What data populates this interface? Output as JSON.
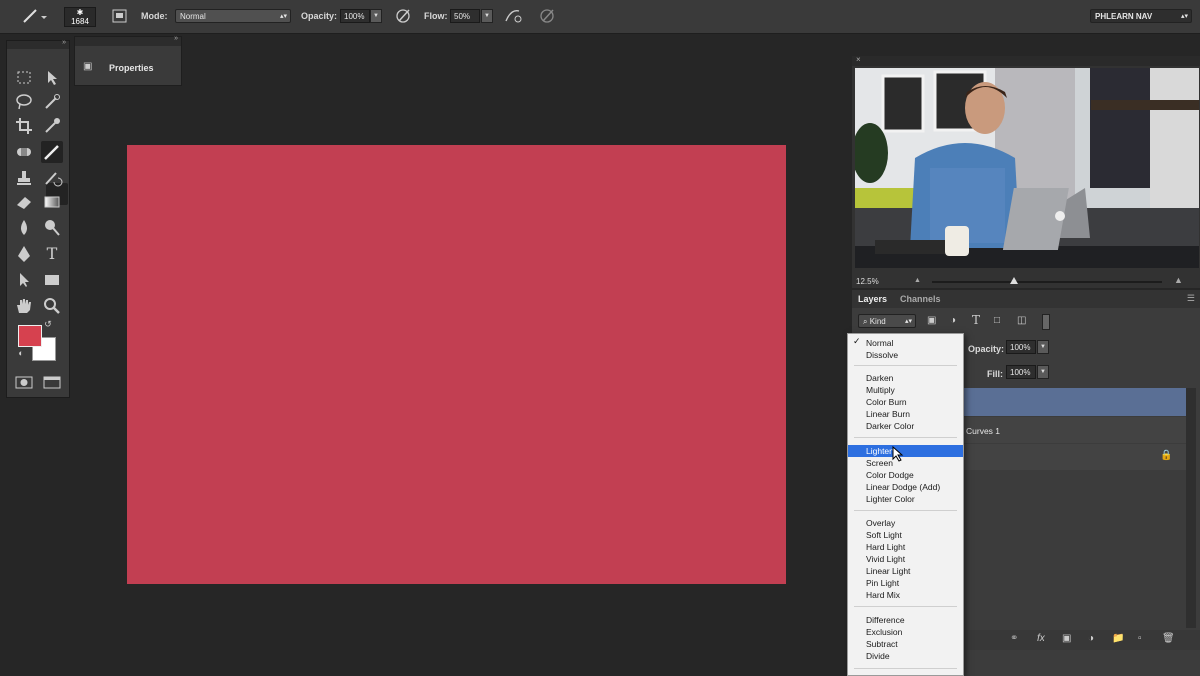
{
  "options_bar": {
    "brush_size": "1684",
    "mode_label": "Mode:",
    "mode_value": "Normal",
    "opacity_label": "Opacity:",
    "opacity_value": "100%",
    "flow_label": "Flow:",
    "flow_value": "50%",
    "workspace": "PHLEARN NAV"
  },
  "properties_panel": {
    "title": "Properties"
  },
  "colors": {
    "foreground": "#d6414f",
    "background": "#ffffff",
    "canvas": "#c23f52"
  },
  "navigator": {
    "zoom": "12.5%"
  },
  "layers_panel": {
    "tabs": [
      "Layers",
      "Channels"
    ],
    "filter": "Kind",
    "opacity_label": "Opacity:",
    "opacity_value": "100%",
    "fill_label": "Fill:",
    "fill_value": "100%",
    "layer_name": "Curves 1"
  },
  "blend_menu": {
    "group1": [
      "Normal",
      "Dissolve"
    ],
    "group2": [
      "Darken",
      "Multiply",
      "Color Burn",
      "Linear Burn",
      "Darker Color"
    ],
    "group3": [
      "Lighten",
      "Screen",
      "Color Dodge",
      "Linear Dodge (Add)",
      "Lighter Color"
    ],
    "group4": [
      "Overlay",
      "Soft Light",
      "Hard Light",
      "Vivid Light",
      "Linear Light",
      "Pin Light",
      "Hard Mix"
    ],
    "group5": [
      "Difference",
      "Exclusion",
      "Subtract",
      "Divide"
    ],
    "checked": "Normal",
    "highlighted": "Lighten"
  }
}
